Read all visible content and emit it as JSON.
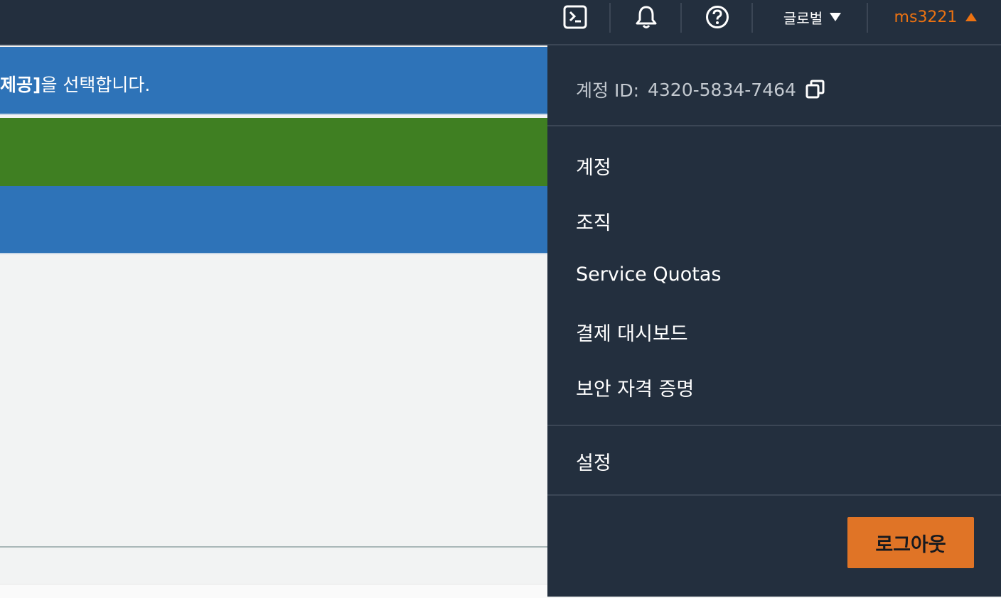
{
  "topnav": {
    "icons": {
      "cloudshell": "cloudshell-icon",
      "notifications": "bell-icon",
      "help": "help-icon"
    },
    "region_label": "글로벌",
    "username": "ms3221"
  },
  "background": {
    "banner_bold": "제공]",
    "banner_text": "을 선택합니다."
  },
  "account_menu": {
    "account_id_label": "계정 ID:",
    "account_id_value": "4320-5834-7464",
    "items": [
      "계정",
      "조직",
      "Service Quotas",
      "결제 대시보드",
      "보안 자격 증명"
    ],
    "settings_label": "설정",
    "logout_label": "로그아웃"
  },
  "colors": {
    "nav_bg": "#232f3e",
    "accent_orange": "#ec7211",
    "logout_button": "#e07426",
    "banner_blue": "#2e73b8",
    "banner_green": "#3f7f22"
  }
}
